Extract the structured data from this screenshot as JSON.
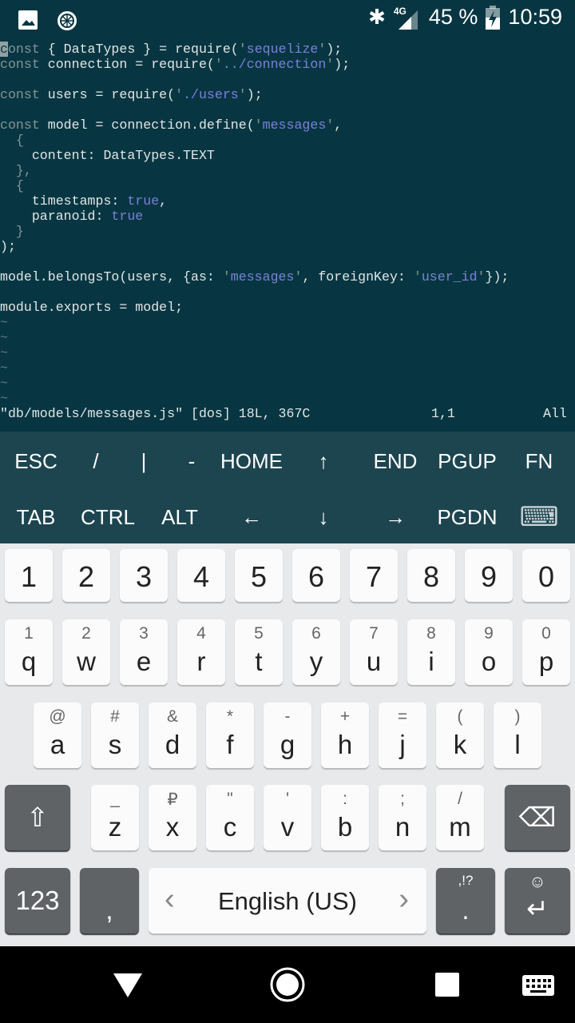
{
  "status_bar": {
    "network": "4G",
    "battery": "45 %",
    "time": "10:59",
    "icons": [
      "gallery-icon",
      "app-icon",
      "bluetooth-icon",
      "signal-icon",
      "battery-charging-icon"
    ]
  },
  "editor": {
    "lines": [
      [
        {
          "t": "c",
          "k": "cur"
        },
        {
          "t": "onst",
          "k": "kw"
        },
        {
          "t": " { DataTypes } = require(",
          "k": ""
        },
        {
          "t": "'",
          "k": "q"
        },
        {
          "t": "sequelize",
          "k": "str"
        },
        {
          "t": "'",
          "k": "q"
        },
        {
          "t": ");",
          "k": ""
        }
      ],
      [
        {
          "t": "const",
          "k": "kw"
        },
        {
          "t": " connection = require(",
          "k": ""
        },
        {
          "t": "'",
          "k": "q"
        },
        {
          "t": "../connection",
          "k": "str"
        },
        {
          "t": "'",
          "k": "q"
        },
        {
          "t": ");",
          "k": ""
        }
      ],
      [],
      [
        {
          "t": "const",
          "k": "kw"
        },
        {
          "t": " users = require(",
          "k": ""
        },
        {
          "t": "'",
          "k": "q"
        },
        {
          "t": "./users",
          "k": "str"
        },
        {
          "t": "'",
          "k": "q"
        },
        {
          "t": ");",
          "k": ""
        }
      ],
      [],
      [
        {
          "t": "const",
          "k": "kw"
        },
        {
          "t": " model = connection.define(",
          "k": ""
        },
        {
          "t": "'",
          "k": "q"
        },
        {
          "t": "messages",
          "k": "str"
        },
        {
          "t": "'",
          "k": "q"
        },
        {
          "t": ",",
          "k": ""
        }
      ],
      [
        {
          "t": "  {",
          "k": "kw"
        }
      ],
      [
        {
          "t": "    content: DataTypes.TEXT",
          "k": ""
        }
      ],
      [
        {
          "t": "  },",
          "k": "kw"
        }
      ],
      [
        {
          "t": "  {",
          "k": "kw"
        }
      ],
      [
        {
          "t": "    timestamps: ",
          "k": ""
        },
        {
          "t": "true",
          "k": "str"
        },
        {
          "t": ",",
          "k": ""
        }
      ],
      [
        {
          "t": "    paranoid: ",
          "k": ""
        },
        {
          "t": "true",
          "k": "str"
        }
      ],
      [
        {
          "t": "  }",
          "k": "kw"
        }
      ],
      [
        {
          "t": ");",
          "k": ""
        }
      ],
      [],
      [
        {
          "t": "model.belongsTo(users, {as: ",
          "k": ""
        },
        {
          "t": "'",
          "k": "q"
        },
        {
          "t": "messages",
          "k": "str"
        },
        {
          "t": "'",
          "k": "q"
        },
        {
          "t": ", foreignKey: ",
          "k": ""
        },
        {
          "t": "'",
          "k": "q"
        },
        {
          "t": "user_id",
          "k": "str"
        },
        {
          "t": "'",
          "k": "q"
        },
        {
          "t": "});",
          "k": ""
        }
      ],
      [],
      [
        {
          "t": "module.exports = model;",
          "k": ""
        }
      ],
      [
        {
          "t": "~",
          "k": "tilde"
        }
      ],
      [
        {
          "t": "~",
          "k": "tilde"
        }
      ],
      [
        {
          "t": "~",
          "k": "tilde"
        }
      ],
      [
        {
          "t": "~",
          "k": "tilde"
        }
      ],
      [
        {
          "t": "~",
          "k": "tilde"
        }
      ],
      [
        {
          "t": "~",
          "k": "tilde"
        }
      ]
    ],
    "status_file": "\"db/models/messages.js\" [dos] 18L, 367C",
    "status_pos": "1,1",
    "status_scroll": "All"
  },
  "extra_keys": [
    [
      "ESC",
      "/",
      "|",
      "-",
      "HOME",
      "↑",
      "END",
      "PGUP",
      "FN"
    ],
    [
      "TAB",
      "CTRL",
      "ALT",
      "←",
      "↓",
      "→",
      "PGDN",
      "⌨"
    ]
  ],
  "keyboard": {
    "numbers": [
      "1",
      "2",
      "3",
      "4",
      "5",
      "6",
      "7",
      "8",
      "9",
      "0"
    ],
    "row1": [
      [
        "q",
        "1"
      ],
      [
        "w",
        "2"
      ],
      [
        "e",
        "3"
      ],
      [
        "r",
        "4"
      ],
      [
        "t",
        "5"
      ],
      [
        "y",
        "6"
      ],
      [
        "u",
        "7"
      ],
      [
        "i",
        "8"
      ],
      [
        "o",
        "9"
      ],
      [
        "p",
        "0"
      ]
    ],
    "row2": [
      [
        "a",
        "@"
      ],
      [
        "s",
        "#"
      ],
      [
        "d",
        "&"
      ],
      [
        "f",
        "*"
      ],
      [
        "g",
        "-"
      ],
      [
        "h",
        "+"
      ],
      [
        "j",
        "="
      ],
      [
        "k",
        "("
      ],
      [
        "l",
        ")"
      ]
    ],
    "row3": [
      [
        "z",
        "_"
      ],
      [
        "x",
        "₽"
      ],
      [
        "c",
        "\""
      ],
      [
        "v",
        "'"
      ],
      [
        "b",
        ":"
      ],
      [
        "n",
        ";"
      ],
      [
        "m",
        "/"
      ]
    ],
    "shift": "⇧",
    "backspace": "⌫",
    "symbols": "123",
    "comma": ",",
    "space": "English (US)",
    "period": ".",
    "period_hint": ",!?",
    "enter": "↵",
    "emoji": "☺"
  }
}
